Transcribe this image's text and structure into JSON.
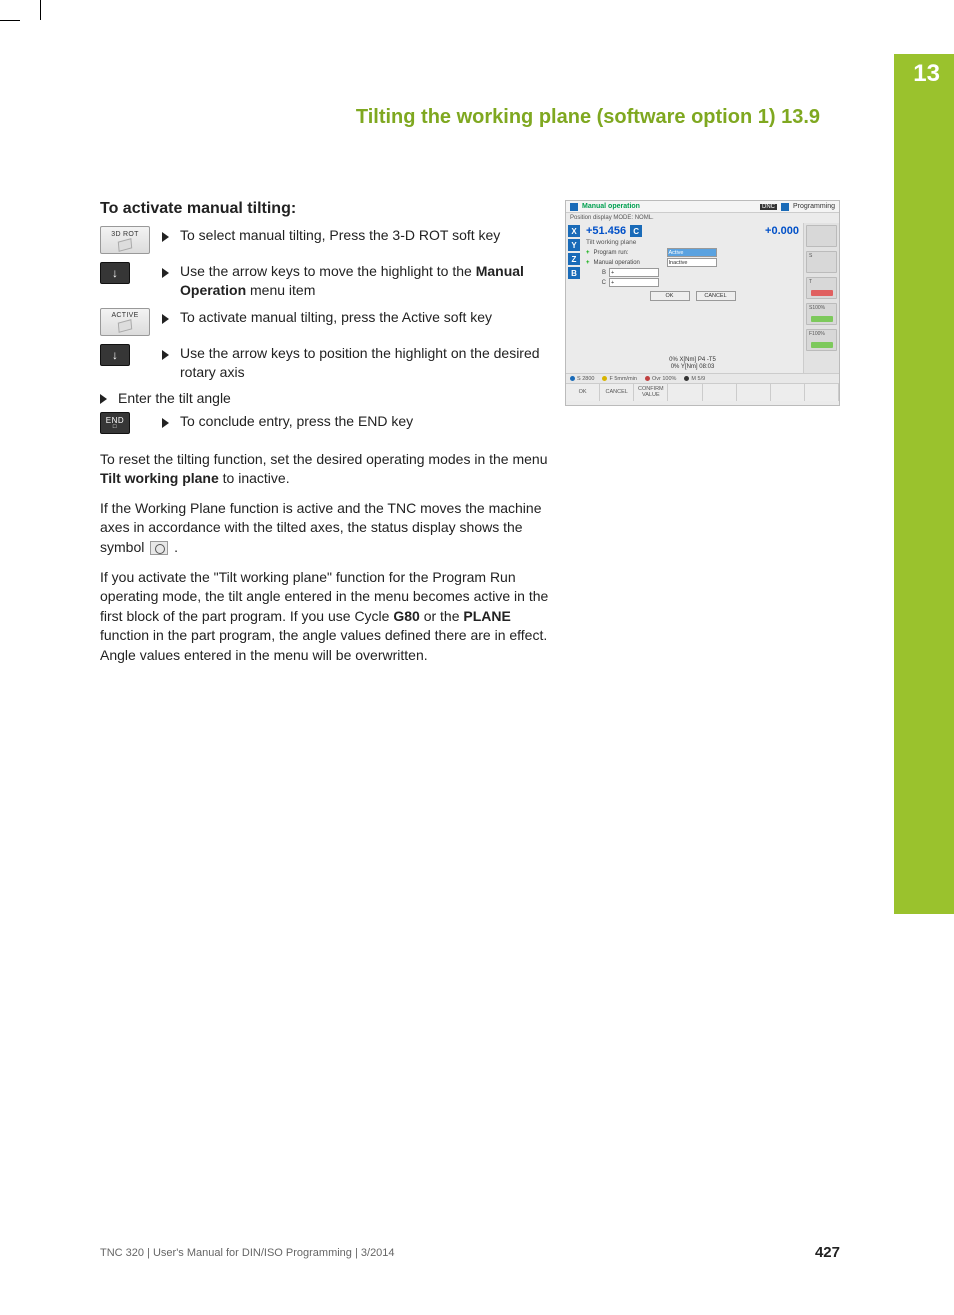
{
  "chapter_number": "13",
  "header_title": "Tilting the working plane (software option 1)   13.9",
  "subhead": "To activate manual tilting:",
  "softkeys": {
    "rot3d": "3D ROT",
    "active": "ACTIVE",
    "end": "END"
  },
  "steps": [
    {
      "icon": "3drot",
      "text_pre": "To select manual tilting, Press the 3-D ROT soft key"
    },
    {
      "icon": "arrow",
      "text_pre": "Use the arrow keys to move the highlight to the ",
      "bold": "Manual Operation",
      "text_post": " menu item"
    },
    {
      "icon": "active",
      "text_pre": "To activate manual tilting, press the Active soft key"
    },
    {
      "icon": "arrow",
      "text_pre": "Use the arrow keys to position the highlight on the desired rotary axis"
    }
  ],
  "enter_tilt": "Enter the tilt angle",
  "step_end": "To conclude entry, press the END key",
  "para1_pre": "To reset the tilting function, set the desired operating modes in the menu ",
  "para1_bold": "Tilt working plane",
  "para1_post": " to inactive.",
  "para2_pre": "If the Working Plane function is active and the TNC moves the machine axes in accordance with the tilted axes, the status display shows the symbol ",
  "para2_post": " .",
  "para3_a": "If you activate the \"Tilt working plane\" function for the Program Run operating mode, the tilt angle entered in the menu becomes active in the first block of the part program. If you use Cycle ",
  "para3_b": "G80",
  "para3_c": " or the ",
  "para3_d": "PLANE",
  "para3_e": " function in the part program, the angle values defined there are in effect. Angle values entered in the menu will be overwritten.",
  "screenshot": {
    "mode_left": "Manual operation",
    "dnc": "DNC",
    "mode_right": "Programming",
    "status_line": "Position display MODE: NOML.",
    "axes": [
      "X",
      "Y",
      "Z",
      "B"
    ],
    "coord_left": "+51.456",
    "coord_letter": "C",
    "coord_right": "+0.000",
    "dialog_title": "Tilt working plane",
    "fields": [
      {
        "label": "Program run:",
        "value": "Active",
        "active": true
      },
      {
        "label": "Manual operation",
        "value": "Inactive",
        "active": false
      },
      {
        "label": "B",
        "value": "+",
        "active": false
      },
      {
        "label": "C",
        "value": "+",
        "active": false
      }
    ],
    "mini_buttons": [
      "OK",
      "CANCEL"
    ],
    "thin_status": {
      "s": "S 2800",
      "f": "F 5mm/min",
      "ovr": "Ovr 100%",
      "m": "M 5/9"
    },
    "lower1": "0% X[Nm]  P4   -T5",
    "lower2": "0% Y[Nm]  08:03",
    "side_labels": [
      "",
      "S",
      "T",
      "S100%",
      "F100%"
    ],
    "footer_keys": [
      "OK",
      "CANCEL",
      "CONFIRM VALUE",
      "",
      "",
      "",
      "",
      ""
    ]
  },
  "footer_left": "TNC 320 | User's Manual for DIN/ISO Programming | 3/2014",
  "footer_page": "427"
}
